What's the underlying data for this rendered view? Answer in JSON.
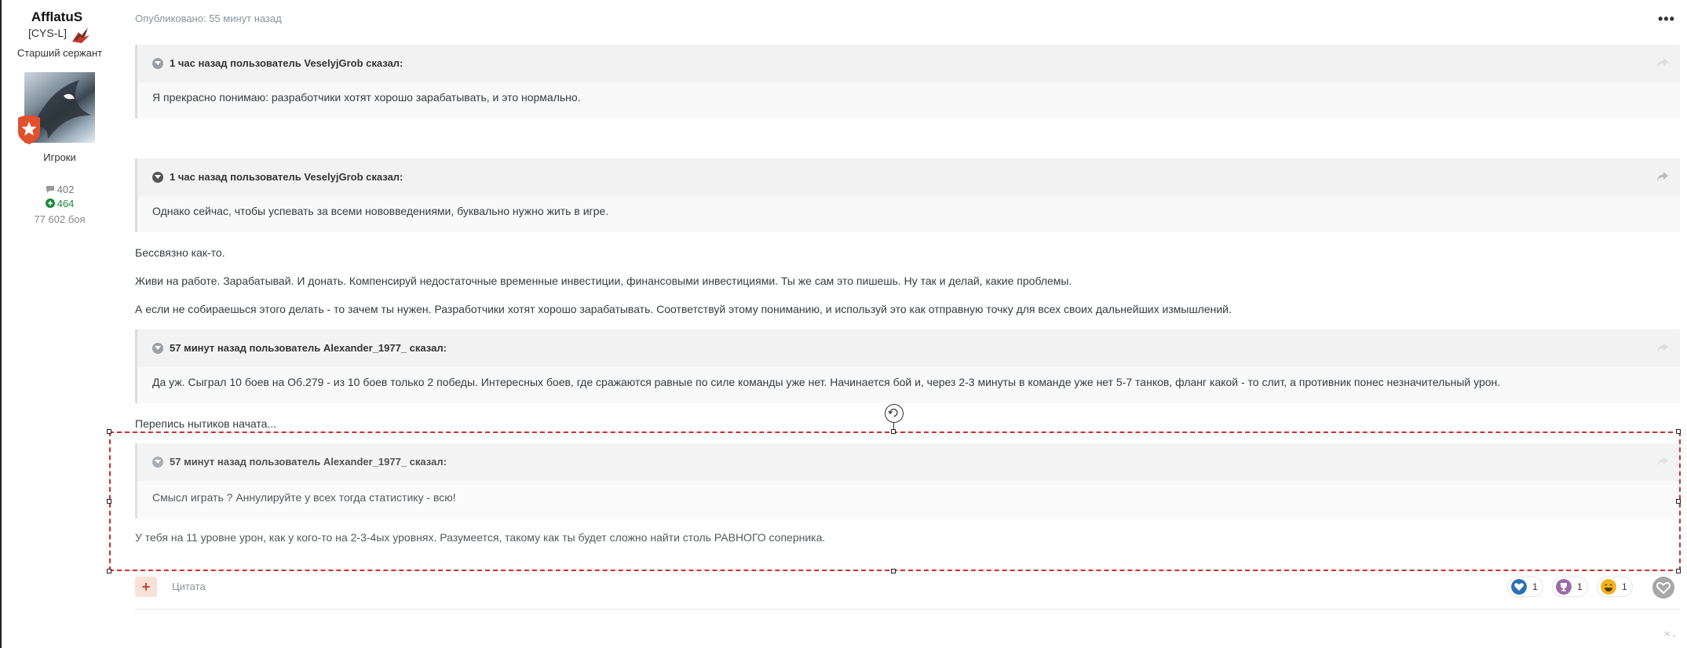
{
  "author": {
    "name": "AfflatuS",
    "clan": "[CYS-L]",
    "rank": "Старший сержант",
    "group": "Игроки",
    "posts": "402",
    "reputation": "464",
    "battles": "77 602 боя"
  },
  "post": {
    "published": "Опубликовано: 55 минут назад",
    "quotes": [
      {
        "cite": "1 час назад пользователь VeselyjGrob сказал:",
        "text": "Я прекрасно понимаю: разработчики хотят хорошо зарабатывать, и это нормально."
      },
      {
        "cite": "1 час назад пользователь VeselyjGrob сказал:",
        "text": "Однако сейчас, чтобы успевать за всеми нововведениями, буквально нужно жить в игре."
      },
      {
        "cite": "57 минут назад пользователь Alexander_1977_ сказал:",
        "text": "Да уж. Сыграл 10 боев на Об.279 - из 10 боев только 2 победы. Интересных боев, где сражаются равные по силе команды уже нет. Начинается бой и, через 2-3 минуты в команде уже нет 5-7 танков, фланг какой - то слит, а противник понес незначительный урон."
      },
      {
        "cite": "57 минут назад пользователь Alexander_1977_ сказал:",
        "text": "Смысл играть ? Аннулируйте у всех тогда статистику - всю!"
      }
    ],
    "paragraphs": [
      "Бессвязно как-то.",
      "Живи на работе. Зарабатывай. И донать. Компенсируй недостаточные временные инвестиции, финансовыми инвестициями. Ты же сам это пишешь. Ну так и делай, какие проблемы.",
      "А если не собираешься этого делать - то зачем ты нужен. Разработчики хотят хорошо зарабатывать. Соответствуй этому пониманию, и используй это как отправную точку для всех своих дальнейших измышлений.",
      "Перепись нытиков начата...",
      "У тебя на 11 уровне урон, как у кого-то на 2-3-4ых уровнях. Разумеется, такому как ты будет сложно найти столь РАВНОГО соперника."
    ]
  },
  "footer": {
    "plus": "+",
    "quote_label": "Цитата",
    "reactions": [
      {
        "name": "heart",
        "count": "1",
        "color": "#2d6fb3"
      },
      {
        "name": "trophy",
        "count": "1",
        "color": "#9b6aa8"
      },
      {
        "name": "laugh",
        "count": "1",
        "color": "#f2b21b"
      }
    ]
  },
  "colors": {
    "accent": "#d12b2b",
    "reputation": "#1c8a3c",
    "badge": "#e2502e"
  }
}
